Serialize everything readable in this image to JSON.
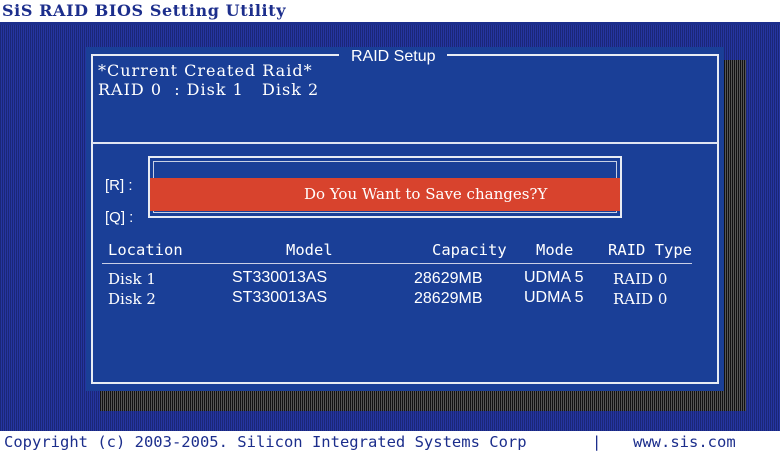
{
  "window": {
    "title": "SiS RAID BIOS Setting Utility"
  },
  "dialog": {
    "title": "RAID Setup",
    "current_label": "*Current Created Raid*",
    "current_value": "RAID 0  : Disk 1   Disk 2",
    "rebuild_hotkey": "[R]",
    "quit_hotkey": "[Q]",
    "confirm_prompt": "Do You Want to Save changes?Y"
  },
  "table": {
    "headers": [
      "Location",
      "Model",
      "Capacity",
      "Mode",
      "RAID Type"
    ],
    "rows": [
      {
        "location": "Disk 1",
        "model": "ST330013AS",
        "capacity": "28629MB",
        "mode": "UDMA 5",
        "raid_type": "RAID 0"
      },
      {
        "location": "Disk 2",
        "model": "ST330013AS",
        "capacity": "28629MB",
        "mode": "UDMA 5",
        "raid_type": "RAID 0"
      }
    ]
  },
  "footer": {
    "copyright": "Copyright (c) 2003-2005. Silicon Integrated Systems Corp",
    "separator": "|",
    "website": "www.sis.com"
  },
  "colors": {
    "background_blue": "#1e2d86",
    "dialog_blue": "#1a3f97",
    "confirm_red": "#d8432d",
    "title_blue": "#1c2e8c",
    "text_white": "#ffffff"
  }
}
